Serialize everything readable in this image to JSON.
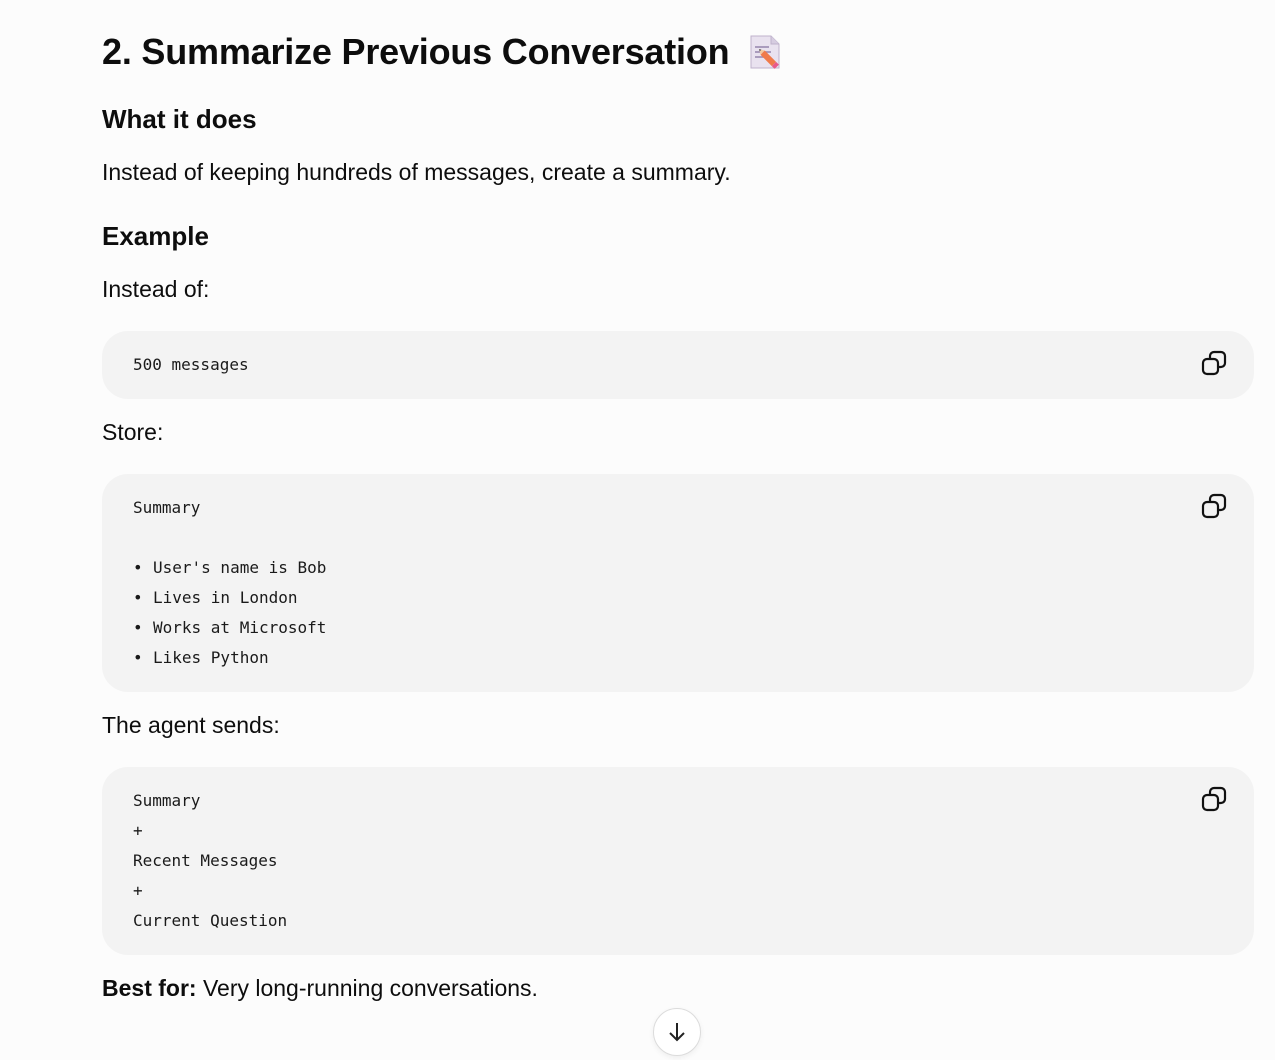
{
  "section": {
    "title": "2. Summarize Previous Conversation",
    "title_icon": "memo-icon"
  },
  "what_it_does": {
    "heading": "What it does",
    "text": "Instead of keeping hundreds of messages, create a summary."
  },
  "example": {
    "heading": "Example",
    "instead_of_label": "Instead of:",
    "instead_of_code": [
      "500 messages"
    ],
    "store_label": "Store:",
    "store_code": {
      "title": "Summary",
      "bullets": [
        "User's name is Bob",
        "Lives in London",
        "Works at Microsoft",
        "Likes Python"
      ]
    },
    "agent_sends_label": "The agent sends:",
    "agent_sends_code": [
      "Summary",
      "+",
      "Recent Messages",
      "+",
      "Current Question"
    ]
  },
  "best_for": {
    "label": "Best for:",
    "text": " Very long-running conversations."
  },
  "icons": {
    "copy": "copy-icon",
    "scroll_down": "arrow-down-icon"
  }
}
